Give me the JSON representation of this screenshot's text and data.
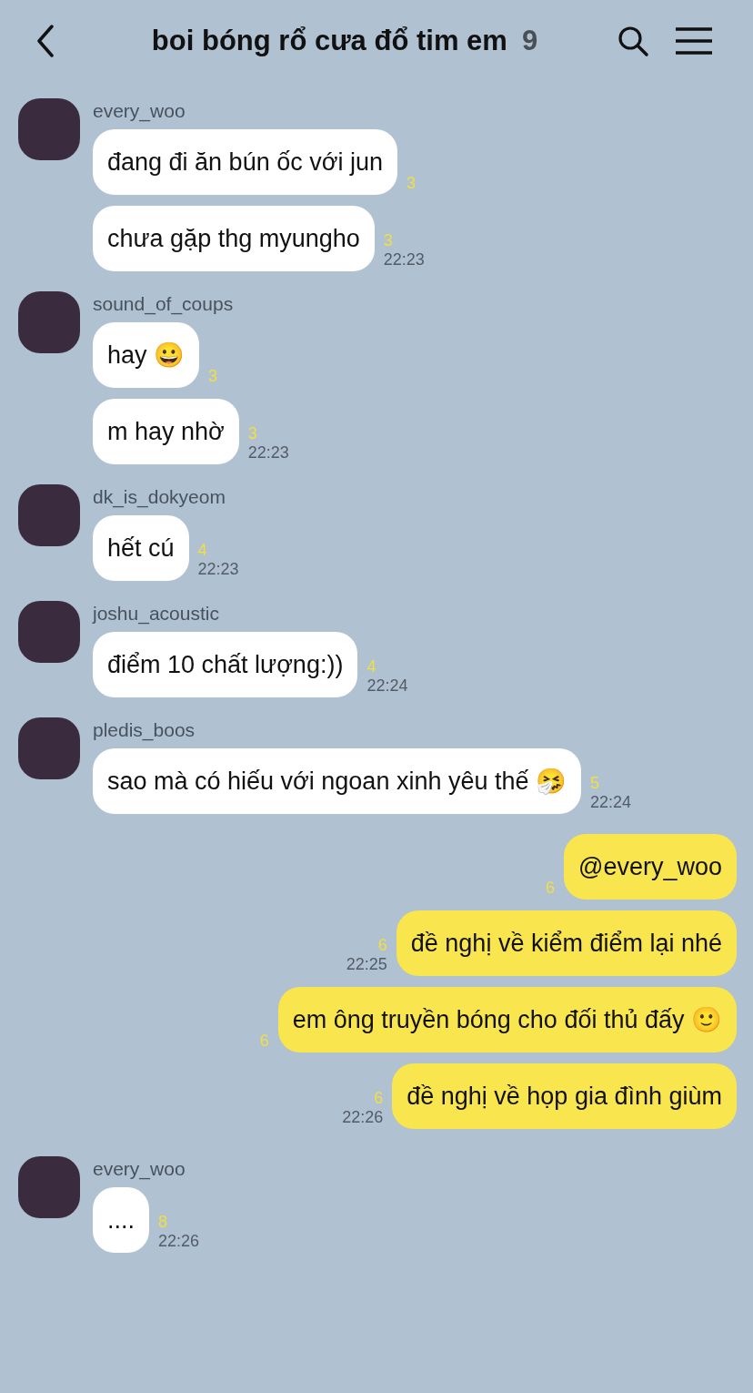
{
  "header": {
    "title": "boi bóng rổ cưa đổ tim em",
    "member_count": "9"
  },
  "groups": [
    {
      "kind": "incoming",
      "sender": "every_woo",
      "messages": [
        {
          "text": "đang đi ăn bún ốc với jun",
          "read": "3"
        },
        {
          "text": "chưa gặp thg myungho",
          "read": "3",
          "time": "22:23"
        }
      ]
    },
    {
      "kind": "incoming",
      "sender": "sound_of_coups",
      "messages": [
        {
          "text": "hay 😀",
          "read": "3"
        },
        {
          "text": "m hay nhờ",
          "read": "3",
          "time": "22:23"
        }
      ]
    },
    {
      "kind": "incoming",
      "sender": "dk_is_dokyeom",
      "messages": [
        {
          "text": "hết cú",
          "read": "4",
          "time": "22:23"
        }
      ]
    },
    {
      "kind": "incoming",
      "sender": "joshu_acoustic",
      "messages": [
        {
          "text": "điểm 10 chất lượng:))",
          "read": "4",
          "time": "22:24"
        }
      ]
    },
    {
      "kind": "incoming",
      "sender": "pledis_boos",
      "messages": [
        {
          "text": "sao mà có hiếu với ngoan xinh yêu thế 🤧",
          "read": "5",
          "time": "22:24"
        }
      ]
    },
    {
      "kind": "outgoing",
      "messages": [
        {
          "text": "@every_woo",
          "read": "6"
        },
        {
          "text": "đề nghị về kiểm điểm lại nhé",
          "read": "6",
          "time": "22:25"
        },
        {
          "text": "em ông truyền bóng cho đối thủ đấy 🙂",
          "read": "6"
        },
        {
          "text": "đề nghị về họp gia đình giùm",
          "read": "6",
          "time": "22:26"
        }
      ]
    },
    {
      "kind": "incoming",
      "sender": "every_woo",
      "messages": [
        {
          "text": "....",
          "read": "8",
          "time": "22:26"
        }
      ]
    }
  ]
}
